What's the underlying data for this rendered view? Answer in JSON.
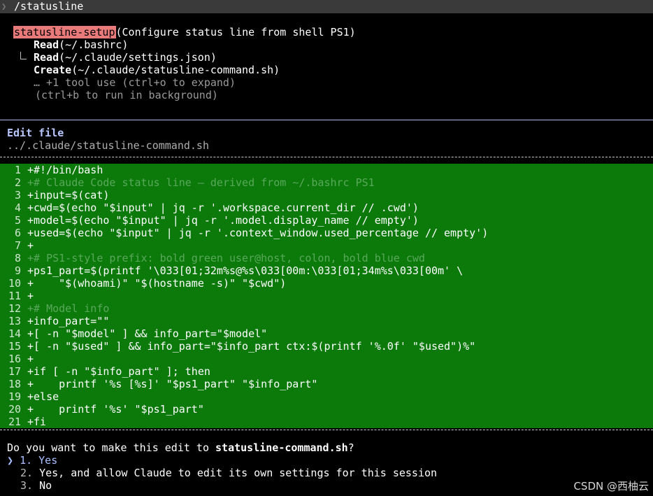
{
  "topbar": {
    "command": "/statusline"
  },
  "task": {
    "name": "statusline-setup",
    "description": "(Configure status line from shell PS1)",
    "steps": [
      {
        "verb": "Read",
        "arg": "(~/.bashrc)"
      },
      {
        "verb": "Read",
        "arg": "(~/.claude/settings.json)"
      },
      {
        "verb": "Create",
        "arg": "(~/.claude/statusline-command.sh)"
      }
    ],
    "more": "… +1 tool use (ctrl+o to expand)",
    "background_hint": "(ctrl+b to run in background)"
  },
  "edit": {
    "title": "Edit file",
    "path": "../.claude/statusline-command.sh"
  },
  "diff": {
    "lines": [
      {
        "n": "1",
        "t": "+#!/bin/bash"
      },
      {
        "n": "2",
        "t": "+# Claude Code status line — derived from ~/.bashrc PS1"
      },
      {
        "n": "3",
        "t": "+input=$(cat)"
      },
      {
        "n": "4",
        "t": "+cwd=$(echo \"$input\" | jq -r '.workspace.current_dir // .cwd')"
      },
      {
        "n": "5",
        "t": "+model=$(echo \"$input\" | jq -r '.model.display_name // empty')"
      },
      {
        "n": "6",
        "t": "+used=$(echo \"$input\" | jq -r '.context_window.used_percentage // empty')"
      },
      {
        "n": "7",
        "t": "+"
      },
      {
        "n": "8",
        "t": "+# PS1-style prefix: bold green user@host, colon, bold blue cwd"
      },
      {
        "n": "9",
        "t": "+ps1_part=$(printf '\\033[01;32m%s@%s\\033[00m:\\033[01;34m%s\\033[00m' \\"
      },
      {
        "n": "10",
        "t": "+    \"$(whoami)\" \"$(hostname -s)\" \"$cwd\")"
      },
      {
        "n": "11",
        "t": "+"
      },
      {
        "n": "12",
        "t": "+# Model info"
      },
      {
        "n": "13",
        "t": "+info_part=\"\""
      },
      {
        "n": "14",
        "t": "+[ -n \"$model\" ] && info_part=\"$model\""
      },
      {
        "n": "15",
        "t": "+[ -n \"$used\" ] && info_part=\"$info_part ctx:$(printf '%.0f' \"$used\")%\""
      },
      {
        "n": "16",
        "t": "+"
      },
      {
        "n": "17",
        "t": "+if [ -n \"$info_part\" ]; then"
      },
      {
        "n": "18",
        "t": "+    printf '%s [%s]' \"$ps1_part\" \"$info_part\""
      },
      {
        "n": "19",
        "t": "+else"
      },
      {
        "n": "20",
        "t": "+    printf '%s' \"$ps1_part\""
      },
      {
        "n": "21",
        "t": "+fi"
      }
    ]
  },
  "prompt": {
    "question_prefix": "Do you want to make this edit to ",
    "question_file": "statusline-command.sh",
    "question_suffix": "?",
    "cursor": "❯",
    "options": [
      {
        "num": "1.",
        "label": "Yes"
      },
      {
        "num": "2.",
        "label": "Yes, and allow Claude to edit its own settings for this session"
      },
      {
        "num": "3.",
        "label": "No"
      }
    ]
  },
  "watermark": "CSDN @西柚云",
  "colors": {
    "diff_bg": "#0b7a0b",
    "task_highlight": "#e87a7a",
    "edit_title": "#b8c8ff",
    "selected_option": "#a8c0ff"
  }
}
